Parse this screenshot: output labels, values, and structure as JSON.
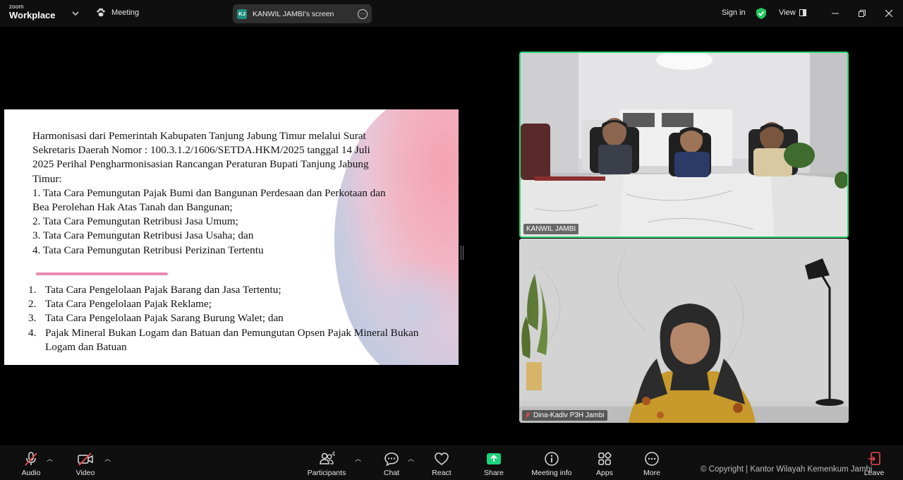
{
  "topbar": {
    "logo_small": "zoom",
    "logo_big": "Workplace",
    "meeting_label": "Meeting",
    "screen_initials": "KJ",
    "screen_label": "KANWIL JAMBI's screen",
    "sign_in": "Sign in",
    "view": "View",
    "security_color": "#23c55e"
  },
  "slide": {
    "paragraph": [
      "Harmonisasi dari Pemerintah Kabupaten Tanjung Jabung Timur melalui Surat",
      "Sekretaris Daerah Nomor : 100.3.1.2/1606/SETDA.HKM/2025 tanggal 14 Juli",
      "2025 Perihal Pengharmonisasian Rancangan Peraturan Bupati Tanjung Jabung",
      "Timur:",
      "1. Tata Cara Pemungutan Pajak Bumi dan Bangunan Perdesaan dan Perkotaan dan",
      "Bea Perolehan Hak Atas Tanah dan Bangunan;",
      "2. Tata Cara Pemungutan Retribusi Jasa Umum;",
      "3. Tata Cara Pemungutan Retribusi Jasa Usaha; dan",
      "4. Tata Cara Pemungutan Retribusi Perizinan Tertentu"
    ],
    "list": [
      {
        "num": "1.",
        "text": "Tata Cara Pengelolaan Pajak Barang dan Jasa Tertentu;"
      },
      {
        "num": "2.",
        "text": "Tata Cara Pengelolaan Pajak Reklame;"
      },
      {
        "num": "3.",
        "text": "Tata Cara Pengelolaan Pajak Sarang Burung Walet; dan"
      },
      {
        "num": "4.",
        "text": "Pajak Mineral Bukan Logam dan Batuan dan Pemungutan Opsen Pajak Mineral Bukan Logam dan Batuan"
      }
    ]
  },
  "videos": {
    "tile1_name": "KANWIL JAMBI",
    "tile2_name": "Dina-Kadiv P3H Jambi",
    "active_speaker_color": "#2ed573"
  },
  "toolbar": {
    "audio": "Audio",
    "video": "Video",
    "participants": "Participants",
    "participants_count": "4",
    "chat": "Chat",
    "react": "React",
    "share": "Share",
    "meeting_info": "Meeting info",
    "apps": "Apps",
    "more": "More",
    "leave": "Leave",
    "share_color": "#1dd37c",
    "leave_color": "#e5484d"
  },
  "watermark": "© Copyright | Kantor Wilayah Kemenkum Jambi"
}
